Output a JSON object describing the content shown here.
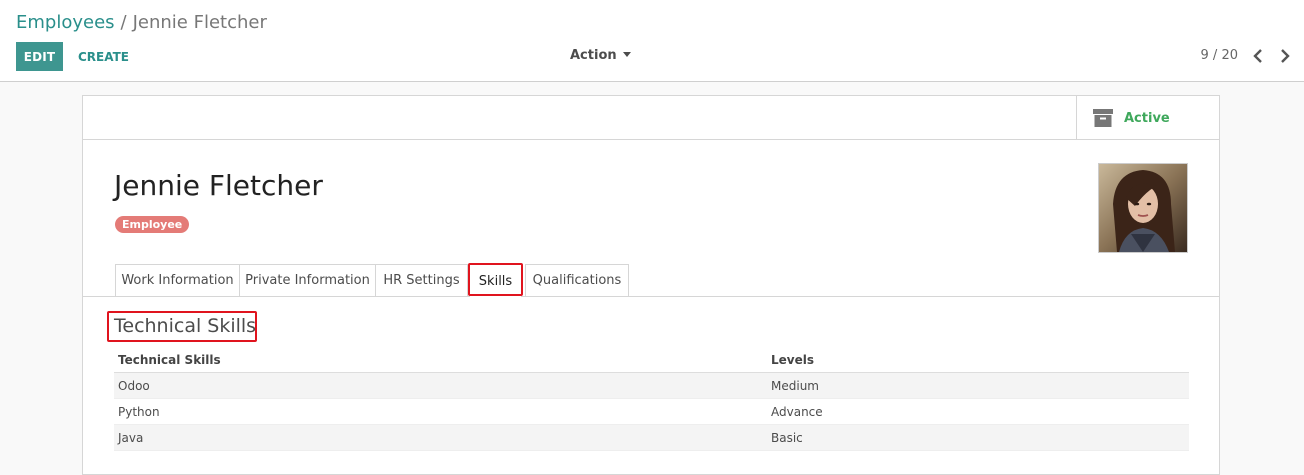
{
  "breadcrumb": {
    "parent": "Employees",
    "separator": "/",
    "current": "Jennie Fletcher"
  },
  "toolbar": {
    "edit_label": "EDIT",
    "create_label": "CREATE",
    "action_label": "Action"
  },
  "pager": {
    "value": "9 / 20"
  },
  "status_button": {
    "label": "Active",
    "icon": "archive-icon",
    "color": "#3fa85c"
  },
  "employee": {
    "name": "Jennie Fletcher",
    "tag": "Employee",
    "tag_color": "#e47b77"
  },
  "tabs": [
    {
      "label": "Work Information",
      "active": false
    },
    {
      "label": "Private Information",
      "active": false
    },
    {
      "label": "HR Settings",
      "active": false
    },
    {
      "label": "Skills",
      "active": true
    },
    {
      "label": "Qualifications",
      "active": false
    }
  ],
  "skills_section": {
    "title": "Technical Skills",
    "columns": [
      "Technical Skills",
      "Levels"
    ],
    "rows": [
      {
        "skill": "Odoo",
        "level": "Medium"
      },
      {
        "skill": "Python",
        "level": "Advance"
      },
      {
        "skill": "Java",
        "level": "Basic"
      }
    ]
  },
  "colors": {
    "primary": "#3e9690",
    "link": "#2a8f8b",
    "highlight": "#e0141e"
  }
}
